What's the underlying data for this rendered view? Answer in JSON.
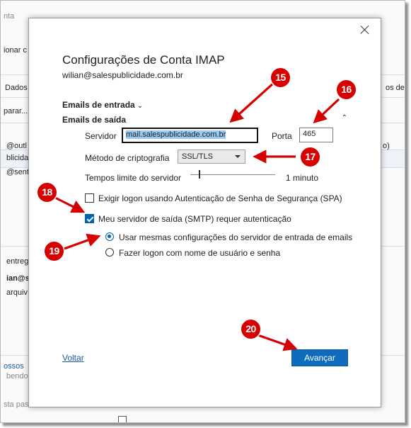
{
  "background": {
    "fragments": [
      "nta",
      "ionar c",
      "Dados",
      "os de",
      "parar...",
      "@outl",
      "blicida",
      "@sentin",
      "o)",
      "entreg",
      "ian@s",
      "arquiv",
      "ossos",
      "bendo",
      "sta pas"
    ]
  },
  "dialog": {
    "title": "Configurações de Conta IMAP",
    "email": "wilian@salespublicidade.com.br",
    "incoming_section": "Emails de entrada",
    "outgoing_section": "Emails de saída",
    "server_label": "Servidor",
    "server_value": "mail.salespublicidade.com.br",
    "port_label": "Porta",
    "port_value": "465",
    "encryption_label": "Método de criptografia",
    "encryption_value": "SSL/TLS",
    "timeout_label": "Tempos limite do servidor",
    "timeout_value": "1 minuto",
    "spa_label": "Exigir logon usando Autenticação de Senha de Segurança (SPA)",
    "smtp_auth_label": "Meu servidor de saída (SMTP) requer autenticação",
    "radio_same_label": "Usar mesmas configurações do servidor de entrada de emails",
    "radio_login_label": "Fazer logon com nome de usuário e senha",
    "back_label": "Voltar",
    "next_label": "Avançar"
  },
  "state": {
    "spa_checked": false,
    "smtp_auth_checked": true,
    "radio_selected": "same"
  },
  "annotations": [
    "15",
    "16",
    "17",
    "18",
    "19",
    "20"
  ],
  "colors": {
    "accent": "#0f6cbd",
    "annotation": "#d60000",
    "selection": "#99c9ef"
  }
}
